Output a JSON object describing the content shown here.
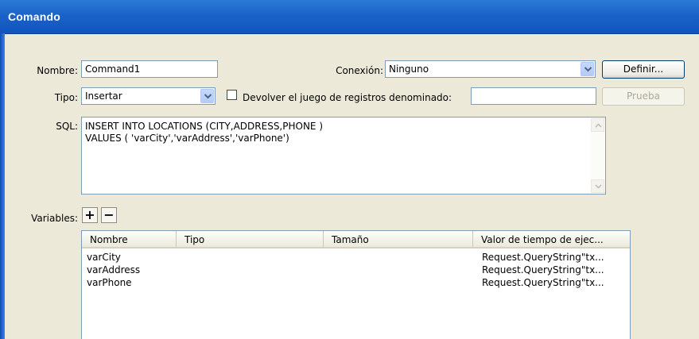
{
  "window": {
    "title": "Comando"
  },
  "form": {
    "name_label": "Nombre:",
    "name_value": "Command1",
    "connection_label": "Conexión:",
    "connection_value": "Ninguno",
    "define_button": "Definir...",
    "type_label": "Tipo:",
    "type_value": "Insertar",
    "return_recordset_label": "Devolver el juego de registros denominado:",
    "return_recordset_checked": false,
    "return_recordset_value": "",
    "test_button": "Prueba",
    "sql_label": "SQL:",
    "sql_lines": [
      "INSERT INTO LOCATIONS (CITY,ADDRESS,PHONE )",
      "VALUES ( 'varCity','varAddress','varPhone')"
    ],
    "variables_label": "Variables:",
    "add_symbol": "+",
    "remove_symbol": "−"
  },
  "variables_table": {
    "columns": [
      "Nombre",
      "Tipo",
      "Tamaño",
      "Valor de tiempo de ejec..."
    ],
    "rows": [
      {
        "name": "varCity",
        "type": "",
        "size": "",
        "runtime": "Request.QueryString\"tx..."
      },
      {
        "name": "varAddress",
        "type": "",
        "size": "",
        "runtime": "Request.QueryString\"tx..."
      },
      {
        "name": "varPhone",
        "type": "",
        "size": "",
        "runtime": "Request.QueryString\"tx..."
      }
    ]
  },
  "icons": {
    "combo_arrow": "chevron-down-icon",
    "scroll_up": "scroll-up-arrow-icon",
    "scroll_down": "scroll-down-arrow-icon"
  },
  "colors": {
    "titlebar": "#1a63c8",
    "dialog_background": "#ece9d8",
    "field_border": "#7f9db9"
  }
}
